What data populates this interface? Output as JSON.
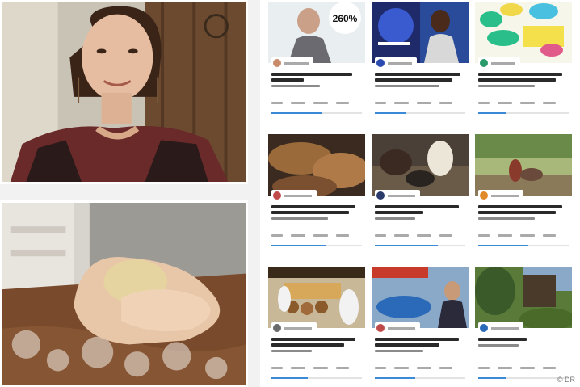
{
  "credit": "© DR",
  "badge_260": "260%",
  "cards": [
    {
      "progress": 0.55
    },
    {
      "progress": 0.35
    },
    {
      "progress": 0.3
    },
    {
      "progress": 0.6
    },
    {
      "progress": 0.7
    },
    {
      "progress": 0.55
    },
    {
      "progress": 0.4
    },
    {
      "progress": 0.45
    },
    {
      "progress": 0.3
    }
  ]
}
